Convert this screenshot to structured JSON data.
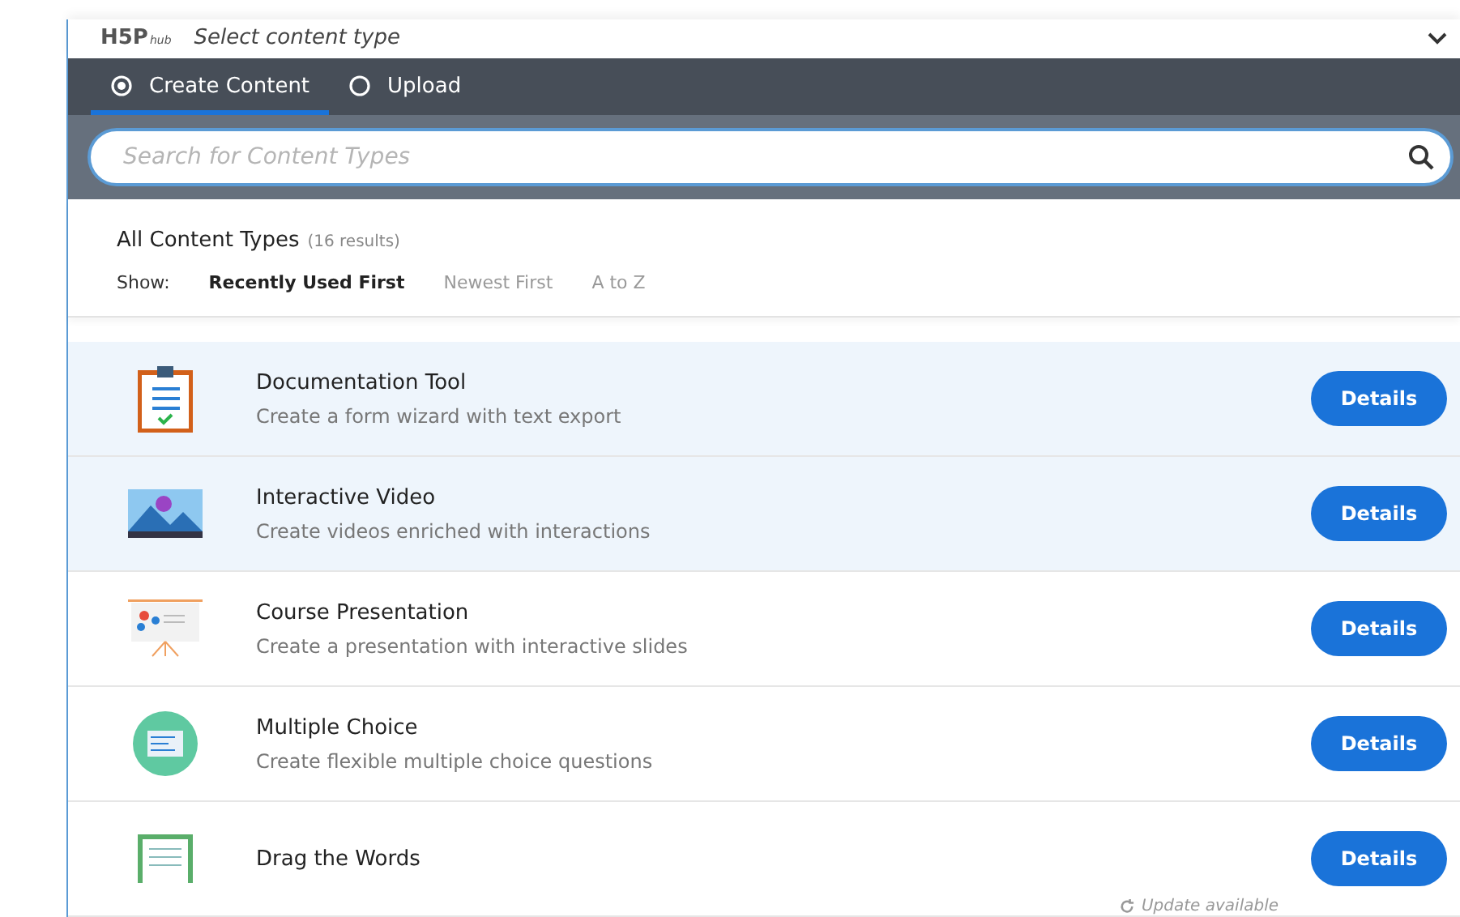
{
  "header": {
    "logo": "H5P",
    "logo_sub": "hub",
    "title": "Select content type",
    "expanded": true
  },
  "tabs": [
    {
      "label": "Create Content",
      "selected": true
    },
    {
      "label": "Upload",
      "selected": false
    }
  ],
  "search": {
    "placeholder": "Search for Content Types"
  },
  "list_header": {
    "title": "All Content Types",
    "count": "(16 results)",
    "show_label": "Show:"
  },
  "sort_options": [
    {
      "label": "Recently Used First",
      "selected": true
    },
    {
      "label": "Newest First",
      "selected": false
    },
    {
      "label": "A to Z",
      "selected": false
    }
  ],
  "items": [
    {
      "title": "Documentation Tool",
      "description": "Create a form wizard with text export",
      "highlighted": true,
      "button": "Details"
    },
    {
      "title": "Interactive Video",
      "description": "Create videos enriched with interactions",
      "highlighted": true,
      "button": "Details"
    },
    {
      "title": "Course Presentation",
      "description": "Create a presentation with interactive slides",
      "highlighted": false,
      "button": "Details"
    },
    {
      "title": "Multiple Choice",
      "description": "Create flexible multiple choice questions",
      "highlighted": false,
      "button": "Details"
    },
    {
      "title": "Drag the Words",
      "highlighted": false,
      "update": "Update available",
      "button": "Details"
    }
  ]
}
